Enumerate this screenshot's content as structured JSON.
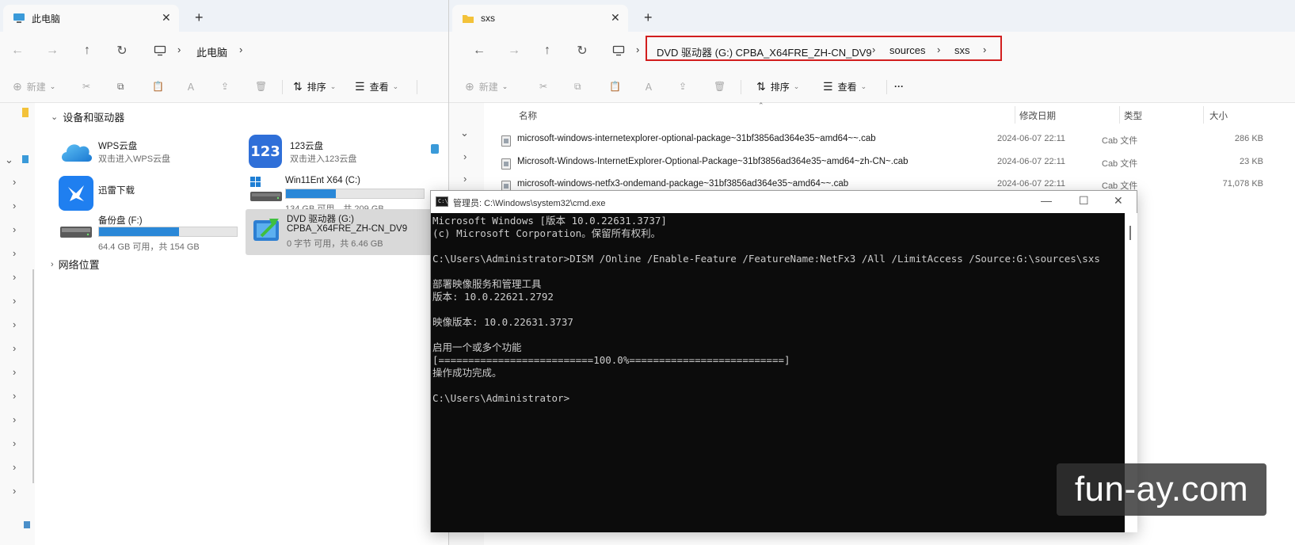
{
  "left_window": {
    "tab_title": "此电脑",
    "tab_close": "✕",
    "new_tab": "+",
    "breadcrumb": [
      "此电脑"
    ],
    "toolbar": {
      "new_label": "新建",
      "sort_label": "排序",
      "view_label": "查看"
    },
    "section_devices": "设备和驱动器",
    "section_network": "网络位置",
    "drives": [
      {
        "name": "WPS云盘",
        "sub": "双击进入WPS云盘"
      },
      {
        "name": "123云盘",
        "sub": "双击进入123云盘"
      },
      {
        "name": "迅雷下载",
        "sub": ""
      },
      {
        "name": "Win11Ent X64 (C:)",
        "sub": "134 GB 可用，共 209 GB",
        "used_fraction": 0.36
      },
      {
        "name": "备份盘 (F:)",
        "sub": "64.4 GB 可用，共 154 GB",
        "used_fraction": 0.58
      },
      {
        "name": "DVD 驱动器 (G:)",
        "name2": "CPBA_X64FRE_ZH-CN_DV9",
        "sub": "0 字节 可用，共 6.46 GB"
      }
    ],
    "icon_text_123": "123"
  },
  "right_window": {
    "tab_title": "sxs",
    "tab_close": "✕",
    "new_tab": "+",
    "breadcrumb": [
      "DVD 驱动器 (G:) CPBA_X64FRE_ZH-CN_DV9",
      "sources",
      "sxs"
    ],
    "toolbar": {
      "new_label": "新建",
      "sort_label": "排序",
      "view_label": "查看",
      "more_label": "···"
    },
    "columns": [
      "名称",
      "修改日期",
      "类型",
      "大小"
    ],
    "files": [
      {
        "name": "microsoft-windows-internetexplorer-optional-package~31bf3856ad364e35~amd64~~.cab",
        "date": "2024-06-07 22:11",
        "type": "Cab 文件",
        "size": "286 KB"
      },
      {
        "name": "Microsoft-Windows-InternetExplorer-Optional-Package~31bf3856ad364e35~amd64~zh-CN~.cab",
        "date": "2024-06-07 22:11",
        "type": "Cab 文件",
        "size": "23 KB"
      },
      {
        "name": "microsoft-windows-netfx3-ondemand-package~31bf3856ad364e35~amd64~~.cab",
        "date": "2024-06-07 22:11",
        "type": "Cab 文件",
        "size": "71,078 KB"
      }
    ],
    "highlight_color": "#d21e1e"
  },
  "cmd": {
    "title": "管理员: C:\\Windows\\system32\\cmd.exe",
    "icon_text": "C:\\",
    "lines": [
      "Microsoft Windows [版本 10.0.22631.3737]",
      "(c) Microsoft Corporation。保留所有权利。",
      "",
      "C:\\Users\\Administrator>DISM /Online /Enable-Feature /FeatureName:NetFx3 /All /LimitAccess /Source:G:\\sources\\sxs",
      "",
      "部署映像服务和管理工具",
      "版本: 10.0.22621.2792",
      "",
      "映像版本: 10.0.22631.3737",
      "",
      "启用一个或多个功能",
      "[==========================100.0%==========================]",
      "操作成功完成。",
      "",
      "C:\\Users\\Administrator>"
    ],
    "minimize": "—",
    "maximize": "☐",
    "close": "✕"
  },
  "watermark": "fun-ay.com"
}
